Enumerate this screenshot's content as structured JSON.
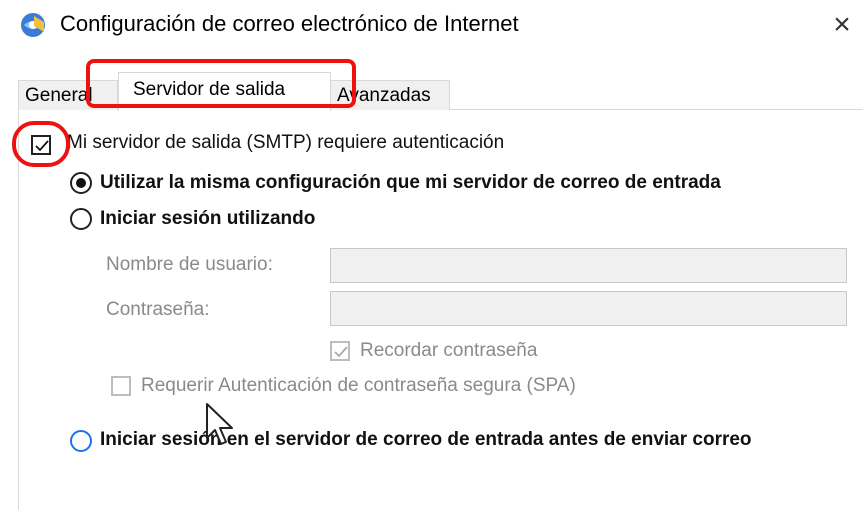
{
  "window": {
    "title": "Configuración de correo electrónico de Internet",
    "close_glyph": "×",
    "icon": "mail-globe-icon"
  },
  "tabs": [
    {
      "label": "General",
      "active": false
    },
    {
      "label": "Servidor de salida",
      "active": true
    },
    {
      "label": "Avanzadas",
      "active": false
    }
  ],
  "panel": {
    "smtp_auth": {
      "label": "Mi servidor de salida (SMTP) requiere autenticación",
      "checked": true
    },
    "radio_same_config": {
      "label": "Utilizar la misma configuración que mi servidor de correo de entrada",
      "selected": true
    },
    "radio_login_with": {
      "label": "Iniciar sesión utilizando",
      "selected": false
    },
    "username": {
      "label": "Nombre de usuario:",
      "value": ""
    },
    "password": {
      "label": "Contraseña:",
      "value": ""
    },
    "remember_password": {
      "label": "Recordar contraseña",
      "checked": true,
      "disabled": true
    },
    "require_spa": {
      "label": "Requerir Autenticación de contraseña segura (SPA)",
      "checked": false,
      "disabled": true
    },
    "radio_login_before_send": {
      "label": "Iniciar sesión en el servidor de correo de entrada antes de enviar correo",
      "selected": false
    }
  },
  "highlights": {
    "color": "#ee1111"
  }
}
